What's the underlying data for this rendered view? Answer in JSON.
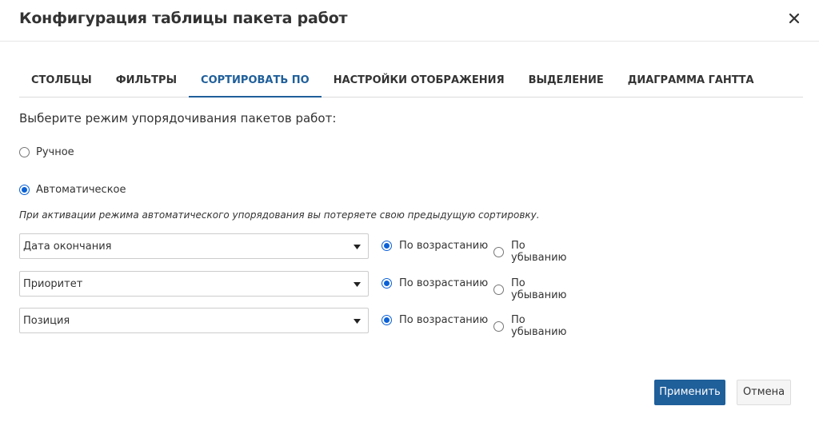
{
  "dialog": {
    "title": "Конфигурация таблицы пакета работ"
  },
  "tabs": [
    {
      "label": "СТОЛБЦЫ",
      "active": false
    },
    {
      "label": "ФИЛЬТРЫ",
      "active": false
    },
    {
      "label": "СОРТИРОВАТЬ ПО",
      "active": true
    },
    {
      "label": "НАСТРОЙКИ ОТОБРАЖЕНИЯ",
      "active": false
    },
    {
      "label": "ВЫДЕЛЕНИЕ",
      "active": false
    },
    {
      "label": "ДИАГРАММА ГАНТТА",
      "active": false
    }
  ],
  "sorting": {
    "prompt": "Выберите режим упорядочивания пакетов работ:",
    "mode_manual": "Ручное",
    "mode_auto": "Автоматическое",
    "selected_mode": "auto",
    "warning": "При активации режима автоматического упорядования вы потеряете свою предыдущую сортировку.",
    "rows": [
      {
        "field": "Дата окончания",
        "asc_label": "По возрастанию",
        "desc_label": "По убыванию",
        "direction": "asc"
      },
      {
        "field": "Приоритет",
        "asc_label": "По возрастанию",
        "desc_label": "По убыванию",
        "direction": "asc"
      },
      {
        "field": "Позиция",
        "asc_label": "По возрастанию",
        "desc_label": "По убыванию",
        "direction": "asc"
      }
    ]
  },
  "footer": {
    "apply_label": "Применить",
    "cancel_label": "Отмена"
  },
  "colors": {
    "accent": "#1f5f9a",
    "radio_checked": "#0b61d6"
  },
  "icons": {
    "close": "close-icon",
    "dropdown": "triangle-down-icon"
  }
}
